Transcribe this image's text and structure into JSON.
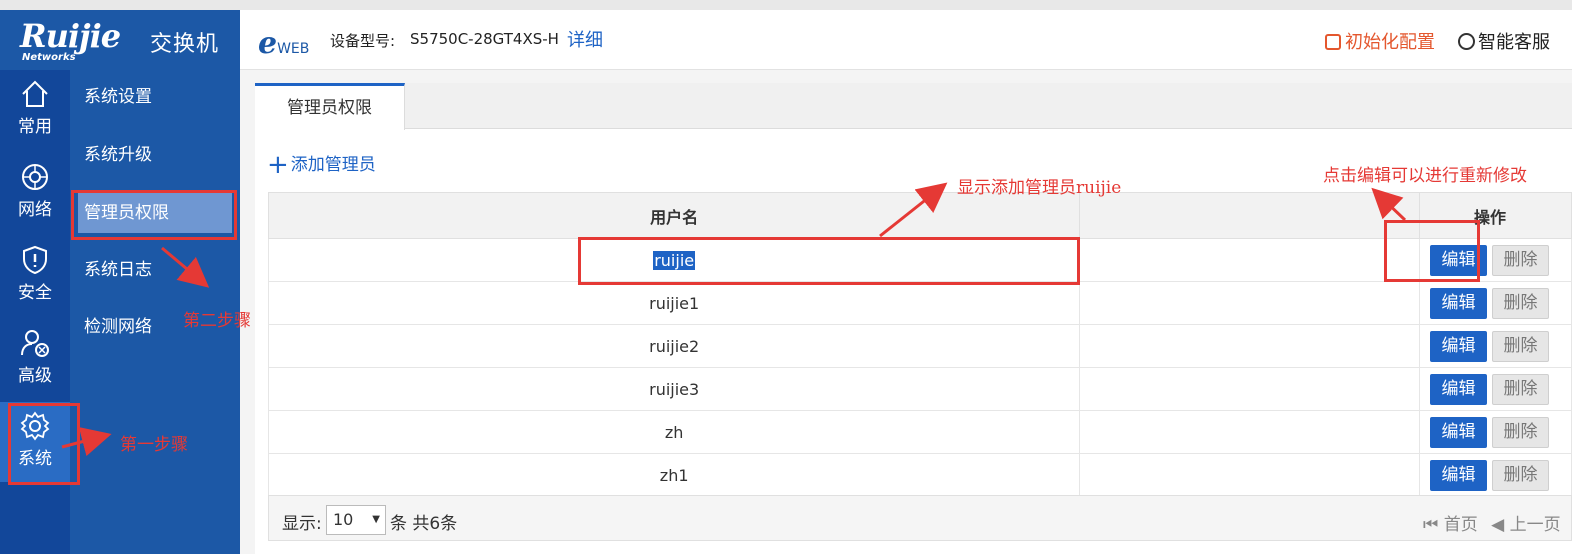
{
  "brand": {
    "logo_word": "Ruijie",
    "logo_sub": "Networks",
    "title": "交换机"
  },
  "header": {
    "eweb_prefix": "e",
    "eweb_word": "WEB",
    "model_label": "设备型号:",
    "model_value": "S5750C-28GT4XS-H",
    "detail_link": "详细",
    "init_config": "初始化配置",
    "smart_support": "智能客服"
  },
  "rail": [
    {
      "label": "常用",
      "icon": "home-icon"
    },
    {
      "label": "网络",
      "icon": "globe-icon"
    },
    {
      "label": "安全",
      "icon": "shield-icon"
    },
    {
      "label": "高级",
      "icon": "user-gear-icon"
    },
    {
      "label": "系统",
      "icon": "gear-icon"
    }
  ],
  "subnav": [
    {
      "label": "系统设置"
    },
    {
      "label": "系统升级"
    },
    {
      "label": "管理员权限"
    },
    {
      "label": "系统日志"
    },
    {
      "label": "检测网络"
    }
  ],
  "tab": {
    "label": "管理员权限"
  },
  "add_admin": {
    "label": "添加管理员"
  },
  "table": {
    "headers": {
      "username": "用户名",
      "blank": "",
      "operation": "操作"
    },
    "rows": [
      {
        "username": "ruijie"
      },
      {
        "username": "ruijie1"
      },
      {
        "username": "ruijie2"
      },
      {
        "username": "ruijie3"
      },
      {
        "username": "zh"
      },
      {
        "username": "zh1"
      }
    ],
    "edit_label": "编辑",
    "delete_label": "删除"
  },
  "footer": {
    "show_label": "显示:",
    "page_size": "10",
    "count_text": "条 共6条",
    "first_page": "首页",
    "prev_page": "上一页"
  },
  "annotations": {
    "step1": "第一步骤",
    "step2": "第二步骤",
    "added_note": "显示添加管理员ruijie",
    "edit_note": "点击编辑可以进行重新修改"
  },
  "colors": {
    "brand_blue": "#1c58a6",
    "accent_blue": "#1e63c5",
    "annotation_red": "#e53935",
    "init_orange": "#e4572e"
  }
}
